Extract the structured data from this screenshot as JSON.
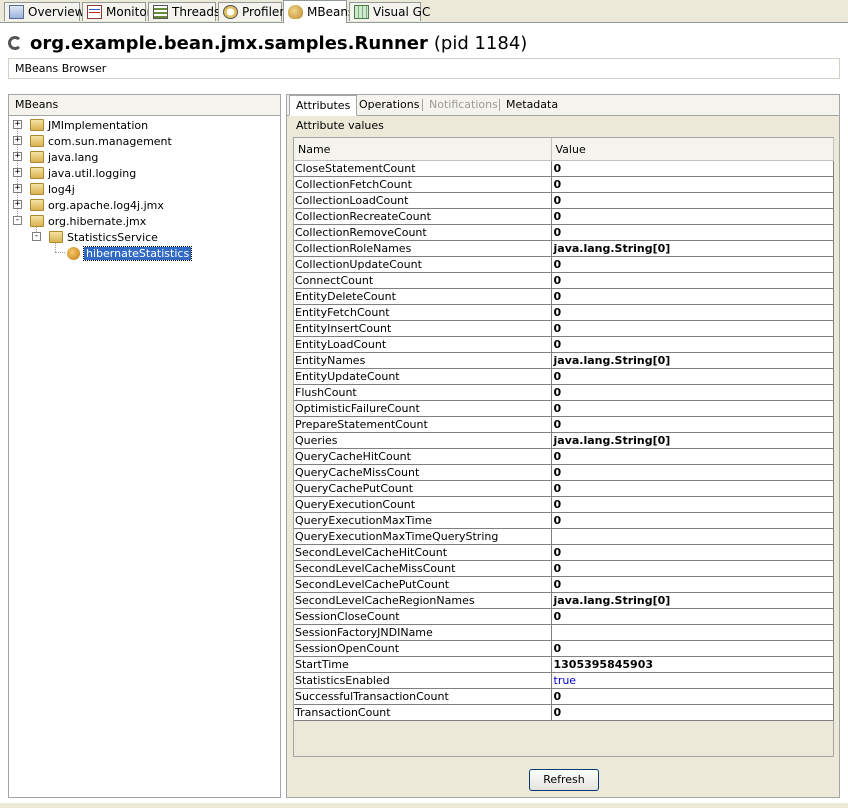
{
  "tabs": [
    {
      "label": "Overview",
      "icon": "overview-icon"
    },
    {
      "label": "Monitor",
      "icon": "monitor-icon"
    },
    {
      "label": "Threads",
      "icon": "threads-icon"
    },
    {
      "label": "Profiler",
      "icon": "profiler-icon"
    },
    {
      "label": "MBeans",
      "icon": "mbeans-icon",
      "active": true
    },
    {
      "label": "Visual GC",
      "icon": "visual-gc-icon"
    }
  ],
  "header": {
    "app_name": "org.example.bean.jmx.samples.Runner",
    "pid": "(pid 1184)"
  },
  "browser_title": "MBeans Browser",
  "mbeans_panel": {
    "title": "MBeans",
    "nodes": [
      {
        "label": "JMImplementation",
        "expander": "+"
      },
      {
        "label": "com.sun.management",
        "expander": "+"
      },
      {
        "label": "java.lang",
        "expander": "+"
      },
      {
        "label": "java.util.logging",
        "expander": "+"
      },
      {
        "label": "log4j",
        "expander": "+"
      },
      {
        "label": "org.apache.log4j.jmx",
        "expander": "+"
      },
      {
        "label": "org.hibernate.jmx",
        "expander": "-"
      },
      {
        "label": "StatisticsService",
        "expander": "-"
      },
      {
        "label": "hibernateStatistics",
        "expander": ""
      }
    ]
  },
  "detail_tabs": [
    {
      "label": "Attributes",
      "active": true
    },
    {
      "label": "Operations"
    },
    {
      "label": "Notifications",
      "disabled": true
    },
    {
      "label": "Metadata"
    }
  ],
  "attributes": {
    "section_label": "Attribute values",
    "columns": [
      "Name",
      "Value"
    ],
    "rows": [
      {
        "name": "CloseStatementCount",
        "value": "0"
      },
      {
        "name": "CollectionFetchCount",
        "value": "0"
      },
      {
        "name": "CollectionLoadCount",
        "value": "0"
      },
      {
        "name": "CollectionRecreateCount",
        "value": "0"
      },
      {
        "name": "CollectionRemoveCount",
        "value": "0"
      },
      {
        "name": "CollectionRoleNames",
        "value": "java.lang.String[0]"
      },
      {
        "name": "CollectionUpdateCount",
        "value": "0"
      },
      {
        "name": "ConnectCount",
        "value": "0"
      },
      {
        "name": "EntityDeleteCount",
        "value": "0"
      },
      {
        "name": "EntityFetchCount",
        "value": "0"
      },
      {
        "name": "EntityInsertCount",
        "value": "0"
      },
      {
        "name": "EntityLoadCount",
        "value": "0"
      },
      {
        "name": "EntityNames",
        "value": "java.lang.String[0]"
      },
      {
        "name": "EntityUpdateCount",
        "value": "0"
      },
      {
        "name": "FlushCount",
        "value": "0"
      },
      {
        "name": "OptimisticFailureCount",
        "value": "0"
      },
      {
        "name": "PrepareStatementCount",
        "value": "0"
      },
      {
        "name": "Queries",
        "value": "java.lang.String[0]"
      },
      {
        "name": "QueryCacheHitCount",
        "value": "0"
      },
      {
        "name": "QueryCacheMissCount",
        "value": "0"
      },
      {
        "name": "QueryCachePutCount",
        "value": "0"
      },
      {
        "name": "QueryExecutionCount",
        "value": "0"
      },
      {
        "name": "QueryExecutionMaxTime",
        "value": "0"
      },
      {
        "name": "QueryExecutionMaxTimeQueryString",
        "value": ""
      },
      {
        "name": "SecondLevelCacheHitCount",
        "value": "0"
      },
      {
        "name": "SecondLevelCacheMissCount",
        "value": "0"
      },
      {
        "name": "SecondLevelCachePutCount",
        "value": "0"
      },
      {
        "name": "SecondLevelCacheRegionNames",
        "value": "java.lang.String[0]"
      },
      {
        "name": "SessionCloseCount",
        "value": "0"
      },
      {
        "name": "SessionFactoryJNDIName",
        "value": ""
      },
      {
        "name": "SessionOpenCount",
        "value": "0"
      },
      {
        "name": "StartTime",
        "value": "1305395845903"
      },
      {
        "name": "StatisticsEnabled",
        "value": "true",
        "editable": true
      },
      {
        "name": "SuccessfulTransactionCount",
        "value": "0"
      },
      {
        "name": "TransactionCount",
        "value": "0"
      }
    ]
  },
  "refresh_label": "Refresh"
}
